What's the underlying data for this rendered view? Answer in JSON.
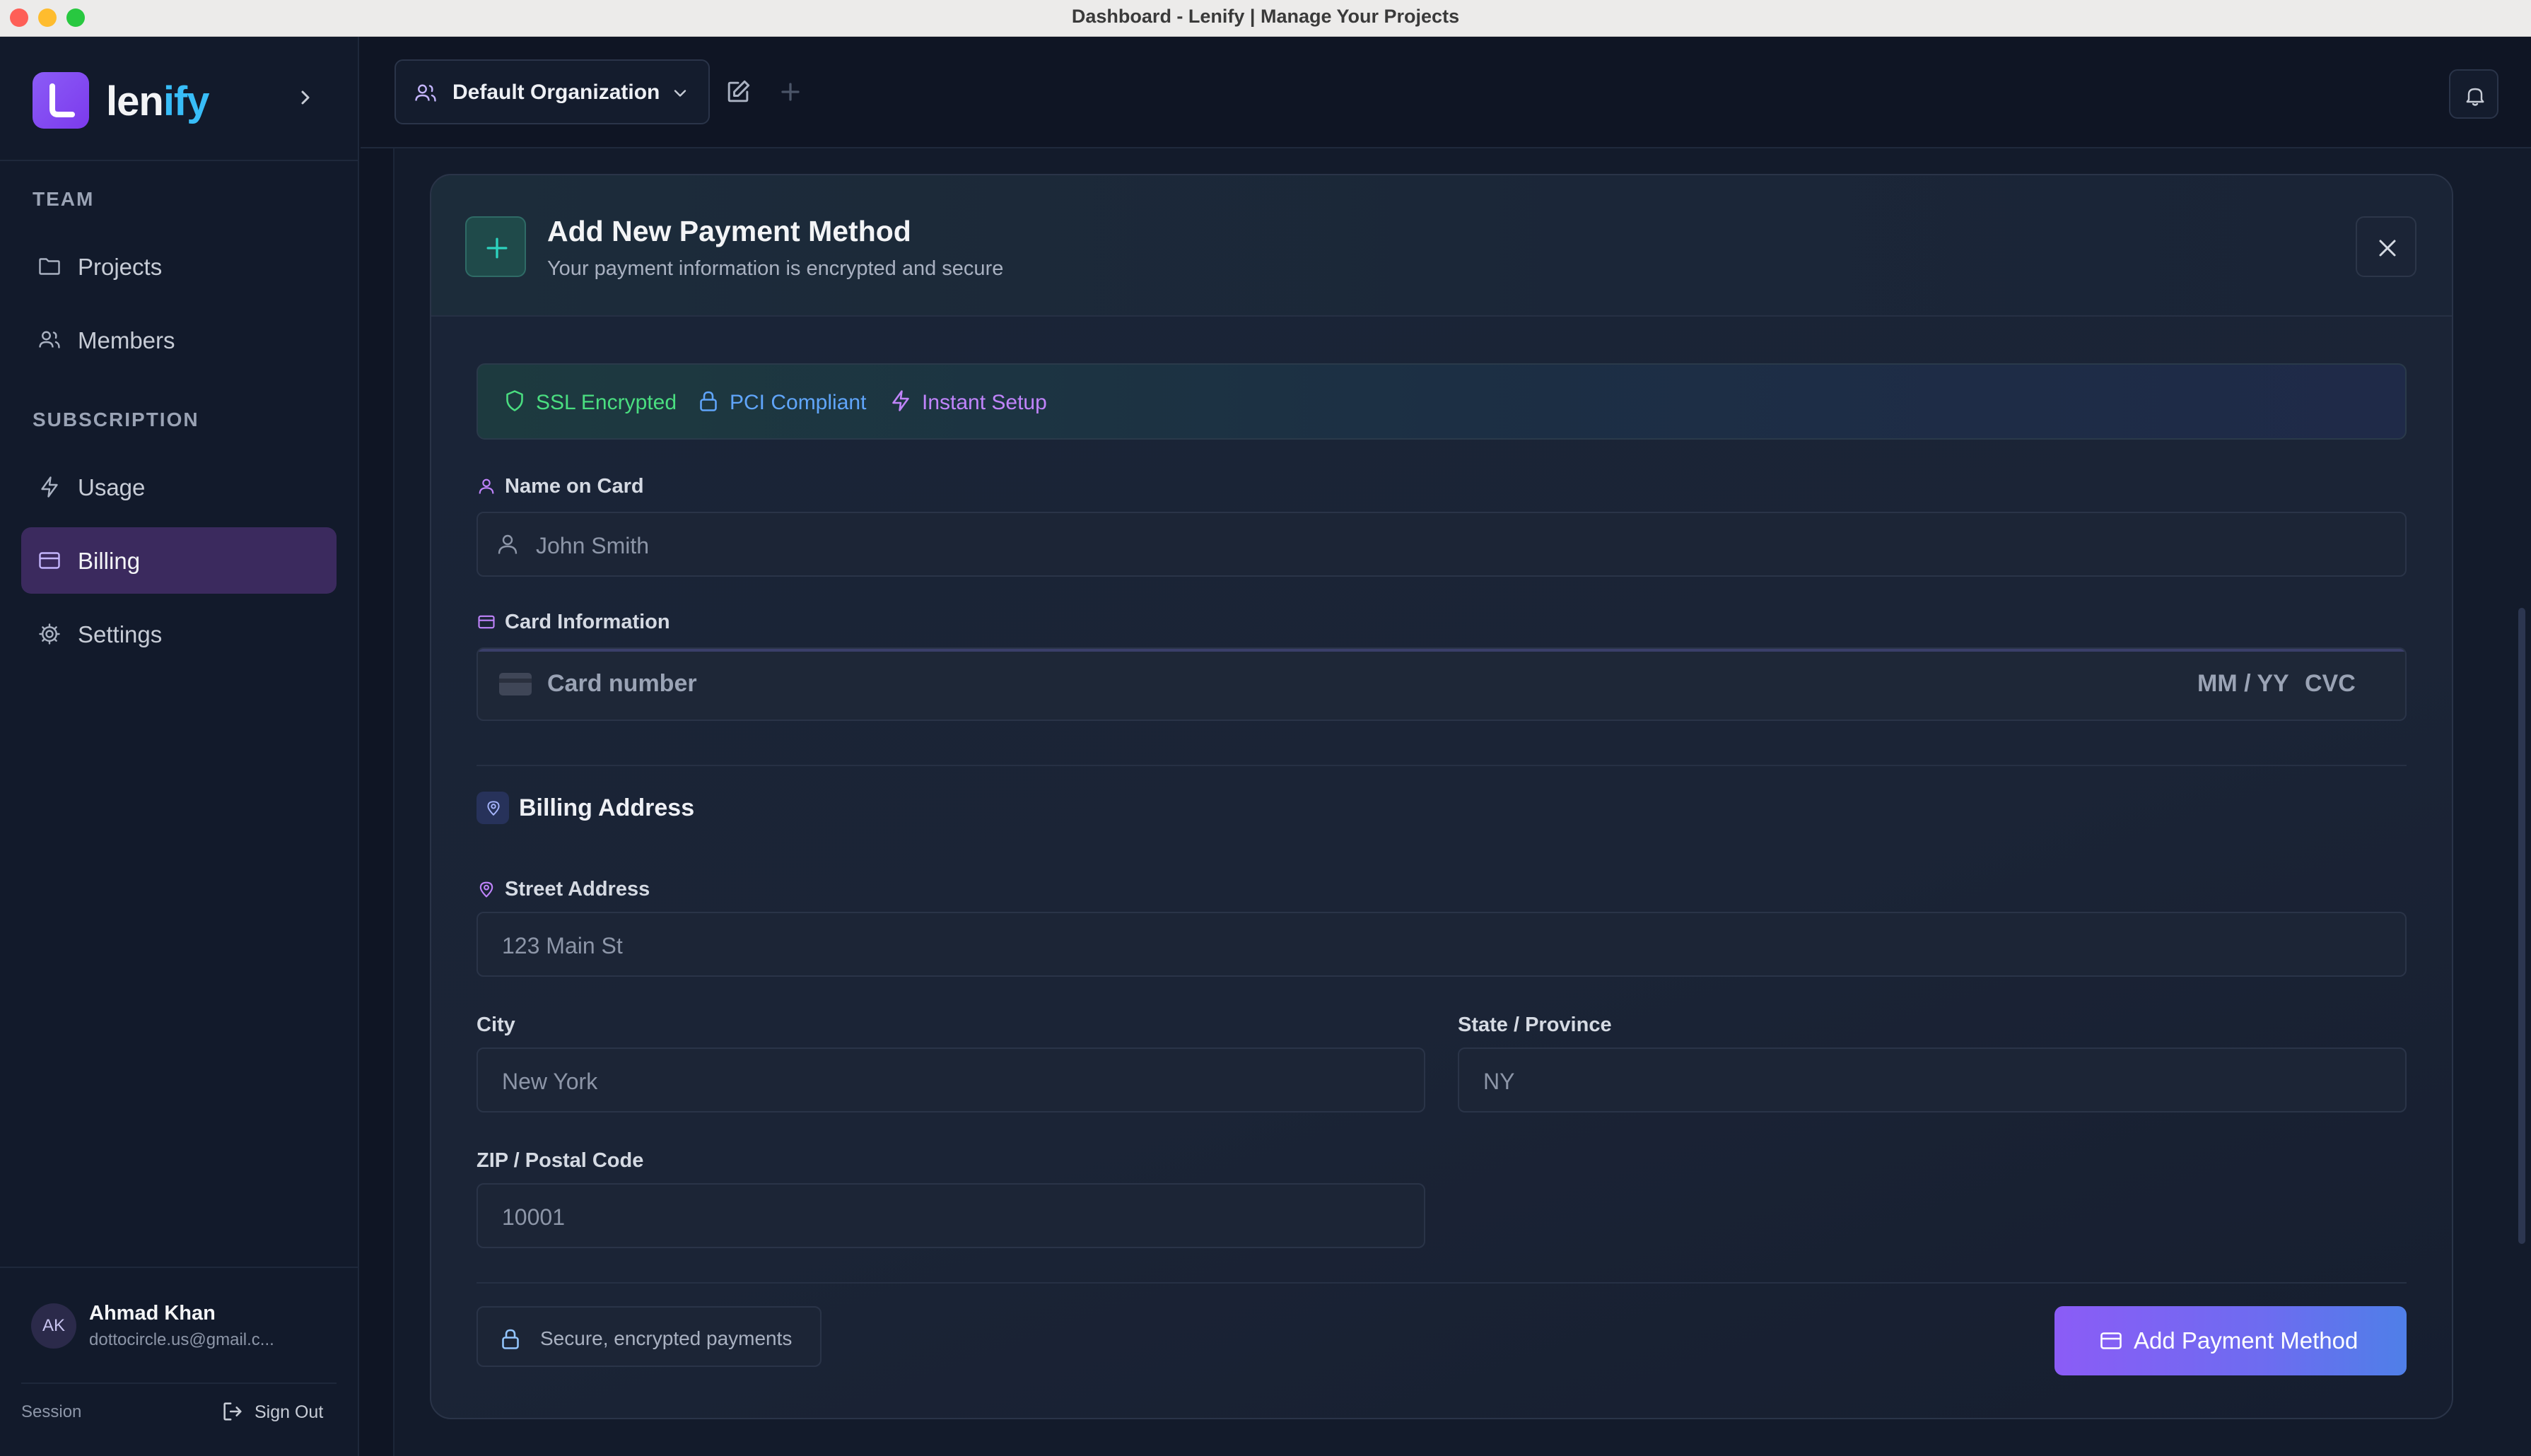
{
  "window": {
    "title": "Dashboard - Lenify | Manage Your Projects",
    "traffic_colors": [
      "#fe5f57",
      "#febc2e",
      "#28c840"
    ]
  },
  "sidebar": {
    "brand_main": "len",
    "brand_highlight": "ify",
    "sections": [
      {
        "label": "TEAM",
        "items": [
          {
            "label": "Projects",
            "icon": "folder-icon"
          },
          {
            "label": "Members",
            "icon": "users-icon"
          }
        ]
      },
      {
        "label": "SUBSCRIPTION",
        "items": [
          {
            "label": "Usage",
            "icon": "zap-icon"
          },
          {
            "label": "Billing",
            "icon": "credit-card-icon",
            "active": true
          },
          {
            "label": "Settings",
            "icon": "gear-icon"
          }
        ]
      }
    ],
    "user": {
      "initials": "AK",
      "name": "Ahmad Khan",
      "email": "dottocircle.us@gmail.c..."
    },
    "session_label": "Session",
    "sign_out_label": "Sign Out"
  },
  "header": {
    "org_name": "Default Organization"
  },
  "payment_form": {
    "title": "Add New Payment Method",
    "subtitle": "Your payment information is encrypted and secure",
    "badges": [
      {
        "label": "SSL Encrypted",
        "icon": "shield-icon",
        "color": "#4ade80"
      },
      {
        "label": "PCI Compliant",
        "icon": "lock-icon",
        "color": "#60a5fa"
      },
      {
        "label": "Instant Setup",
        "icon": "zap-icon",
        "color": "#c084fc"
      }
    ],
    "name_label": "Name on Card",
    "name_placeholder": "John Smith",
    "card_label": "Card Information",
    "card_number_placeholder": "Card number",
    "card_expiry_placeholder": "MM / YY",
    "card_cvc_placeholder": "CVC",
    "billing_title": "Billing Address",
    "street_label": "Street Address",
    "street_placeholder": "123 Main St",
    "city_label": "City",
    "city_placeholder": "New York",
    "state_label": "State / Province",
    "state_placeholder": "NY",
    "zip_label": "ZIP / Postal Code",
    "zip_placeholder": "10001",
    "secure_note": "Secure, encrypted payments",
    "submit_label": "Add Payment Method"
  },
  "colors": {
    "accent": "#8b5cf6",
    "accent_blue": "#4f7fe8",
    "teal": "#2dd4bf",
    "sidebar_active": "#3b2a5e"
  }
}
